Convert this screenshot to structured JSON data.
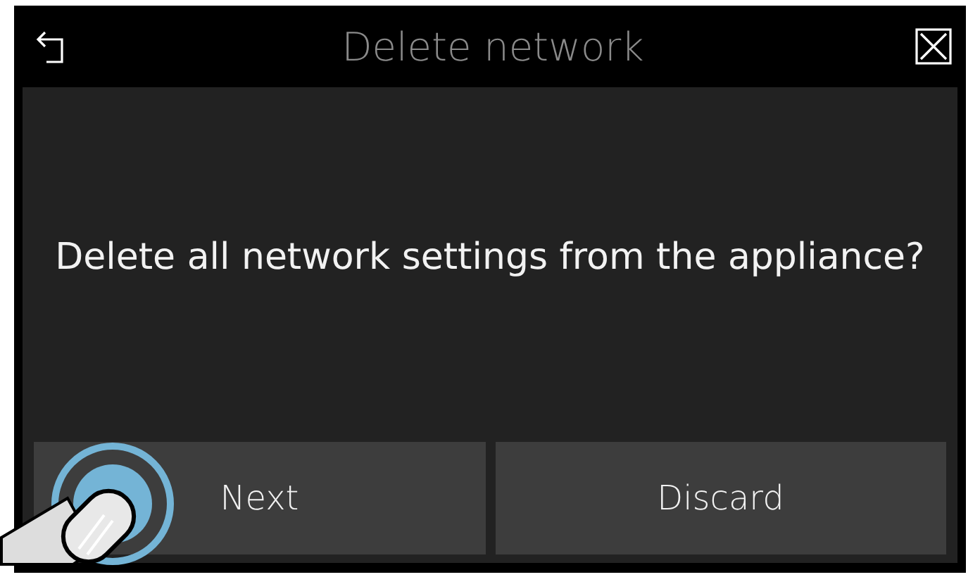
{
  "header": {
    "title": "Delete network"
  },
  "message": "Delete all network settings from the appliance?",
  "buttons": [
    {
      "label": "Next",
      "tap_hint": true
    },
    {
      "label": "Discard",
      "tap_hint": false
    }
  ]
}
